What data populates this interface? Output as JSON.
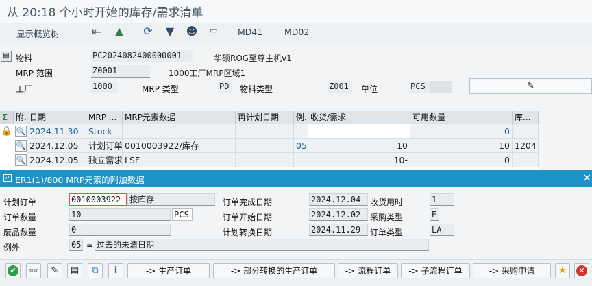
{
  "window": {
    "title": "从 20:18 个小时开始的库存/需求清单"
  },
  "toolbar": {
    "show_overview_tree": "显示概览树",
    "md41": "MD41",
    "md02": "MD02"
  },
  "header": {
    "material_label": "物料",
    "material_value": "PC2024082400000001",
    "material_desc": "华硕ROG至尊主机v1",
    "mrp_area_label": "MRP 范围",
    "mrp_area_value": "Z0001",
    "mrp_area_desc": "1000工厂MRP区域1",
    "plant_label": "工厂",
    "plant_value": "1000",
    "mrp_type_label": "MRP 类型",
    "mrp_type_value": "PD",
    "material_type_label": "物料类型",
    "material_type_value": "Z001",
    "unit_label": "单位",
    "unit_value": "PCS"
  },
  "grid": {
    "sigma": "Σ",
    "columns": [
      "附.",
      "日期",
      "MRP ...",
      "MRP元素数据",
      "再计划日期",
      "例.",
      "收货/需求",
      "可用数量",
      "库..."
    ],
    "rows": [
      {
        "date": "2024.11.30",
        "mrp": "Stock",
        "data": "",
        "resched": "",
        "exc": "",
        "recreq": "",
        "avail": "0",
        "stor": ""
      },
      {
        "date": "2024.12.05",
        "mrp": "计划订单",
        "data": "0010003922/库存",
        "resched": "",
        "exc": "05",
        "recreq": "10",
        "avail": "10",
        "stor": "1204"
      },
      {
        "date": "2024.12.05",
        "mrp": "独立需求",
        "data": "LSF",
        "resched": "",
        "exc": "",
        "recreq": "10-",
        "avail": "0",
        "stor": ""
      }
    ]
  },
  "popup": {
    "title": "ER1(1)/800 MRP元素的附加数据",
    "close": "×",
    "planned_order_label": "计划订单",
    "planned_order_value": "0010003922",
    "planned_order_desc": "按库存",
    "order_qty_label": "订单数量",
    "order_qty_value": "10",
    "order_qty_unit": "PCS",
    "scrap_label": "废品数量",
    "scrap_value": "0",
    "exception_label": "例外",
    "exception_code": "05",
    "exception_eq": "=",
    "exception_text": "过去的未清日期",
    "finish_label": "订单完成日期",
    "finish_value": "2024.12.04",
    "gr_time_label": "收货用时",
    "gr_time_value": "1",
    "start_label": "订单开始日期",
    "start_value": "2024.12.02",
    "proc_type_label": "采购类型",
    "proc_type_value": "E",
    "conv_label": "计划转换日期",
    "conv_value": "2024.11.29",
    "order_type_label": "订单类型",
    "order_type_value": "LA",
    "btn_production_order": "-> 生产订单",
    "btn_partial_conv": "-> 部分转换的生产订单",
    "btn_process_order": "-> 流程订单",
    "btn_sub_process_order": "-> 子流程订单",
    "btn_purchase_req": "-> 采购申请"
  },
  "colors": {
    "accent": "#1c94c8",
    "link": "#1f5fa3"
  }
}
